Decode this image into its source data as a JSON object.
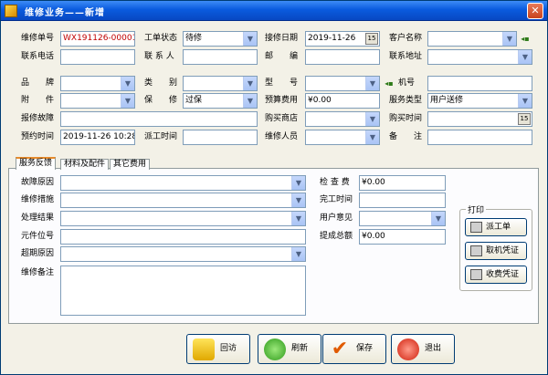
{
  "window": {
    "title": "维修业务——新增"
  },
  "header": {
    "repair_no_label": "维修单号",
    "repair_no": "WX191126-00001",
    "status_label": "工单状态",
    "status": "待修",
    "date_label": "接修日期",
    "date": "2019-11-26",
    "customer_label": "客户名称",
    "phone_label": "联系电话",
    "contact_label": "联 系 人",
    "zip_label": "邮　　编",
    "address_label": "联系地址",
    "brand_label": "品　　牌",
    "category_label": "类　　别",
    "model_label": "型　　号",
    "serial_label": "机号",
    "accessory_label": "附　　件",
    "warranty_label": "保　　修",
    "warranty": "过保",
    "budget_label": "预算费用",
    "budget": "¥0.00",
    "service_label": "服务类型",
    "service": "用户送修",
    "fault_label": "报修故障",
    "shop_label": "购买商店",
    "buy_time_label": "购买时间",
    "appoint_label": "预约时间",
    "appoint": "2019-11-26 10:28",
    "dispatch_label": "派工时间",
    "staff_label": "维修人员",
    "remark_label": "备　　注"
  },
  "tabs": [
    "服务反馈",
    "材料及配件",
    "其它费用"
  ],
  "feedback": {
    "fault_reason_label": "故障原因",
    "measure_label": "维修措施",
    "result_label": "处理结果",
    "part_label": "元件位号",
    "overdue_label": "超期原因",
    "note_label": "维修备注",
    "check_fee_label": "检 查 费",
    "check_fee": "¥0.00",
    "finish_label": "完工时间",
    "opinion_label": "用户意见",
    "commission_label": "提成总额",
    "commission": "¥0.00"
  },
  "print": {
    "title": "打印",
    "dispatch": "派工单",
    "pickup": "取机凭证",
    "receipt": "收费凭证"
  },
  "actions": {
    "visit": "回访",
    "refresh": "刷新",
    "save": "保存",
    "exit": "退出"
  }
}
